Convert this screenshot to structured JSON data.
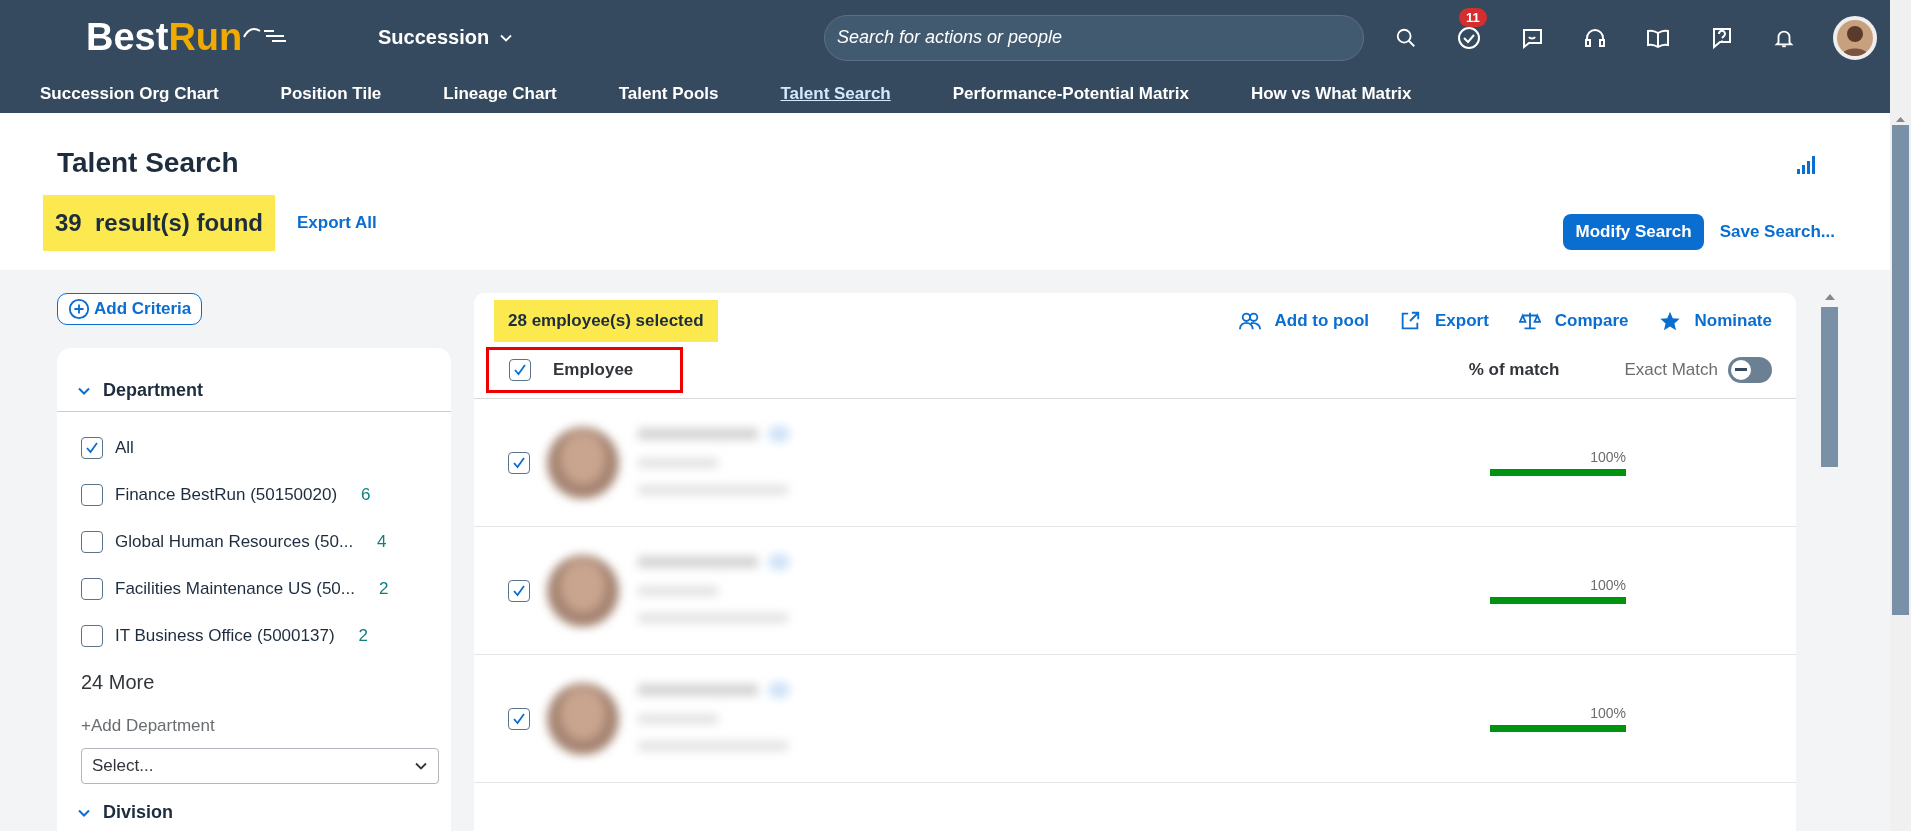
{
  "header": {
    "logo": {
      "first": "Best",
      "second": "Run"
    },
    "module": "Succession",
    "search": {
      "placeholder": "Search for actions or people"
    },
    "notifications_badge": "11"
  },
  "nav": [
    {
      "label": "Succession Org Chart",
      "selected": false
    },
    {
      "label": "Position Tile",
      "selected": false
    },
    {
      "label": "Lineage Chart",
      "selected": false
    },
    {
      "label": "Talent Pools",
      "selected": false
    },
    {
      "label": "Talent Search",
      "selected": true
    },
    {
      "label": "Performance-Potential Matrix",
      "selected": false
    },
    {
      "label": "How vs What Matrix",
      "selected": false
    }
  ],
  "page": {
    "title": "Talent Search",
    "result_count": "39  result(s) found",
    "export_all": "Export All",
    "modify_search": "Modify Search",
    "save_search": "Save Search..."
  },
  "filters": {
    "add_criteria": "Add Criteria",
    "groups": [
      {
        "title": "Department",
        "expanded": true,
        "options": [
          {
            "label": "All",
            "checked": true
          },
          {
            "label": "Finance BestRun (50150020)",
            "count": "6",
            "checked": false
          },
          {
            "label": "Global Human Resources (50...",
            "count": "4",
            "checked": false
          },
          {
            "label": "Facilities Maintenance US (50...",
            "count": "2",
            "checked": false
          },
          {
            "label": "IT Business Office (5000137)",
            "count": "2",
            "checked": false
          }
        ],
        "more": "24 More",
        "add_label": "+Add Department",
        "select_placeholder": "Select..."
      },
      {
        "title": "Division",
        "expanded": true
      }
    ]
  },
  "results": {
    "selected_count": "28 employee(s) selected",
    "actions": [
      {
        "kind": "pool",
        "label": "Add to pool"
      },
      {
        "kind": "export",
        "label": "Export"
      },
      {
        "kind": "compare",
        "label": "Compare"
      },
      {
        "kind": "nominate",
        "label": "Nominate"
      }
    ],
    "columns": {
      "employee": "Employee",
      "match": "% of match",
      "exact_match": "Exact Match"
    },
    "all_checked": true,
    "exact_match_on": false,
    "rows": [
      {
        "checked": true,
        "level": 1,
        "reading": "100%"
      },
      {
        "checked": true,
        "level": 1,
        "reading": "100%"
      },
      {
        "checked": true,
        "level": 1,
        "reading": "100%"
      }
    ]
  }
}
